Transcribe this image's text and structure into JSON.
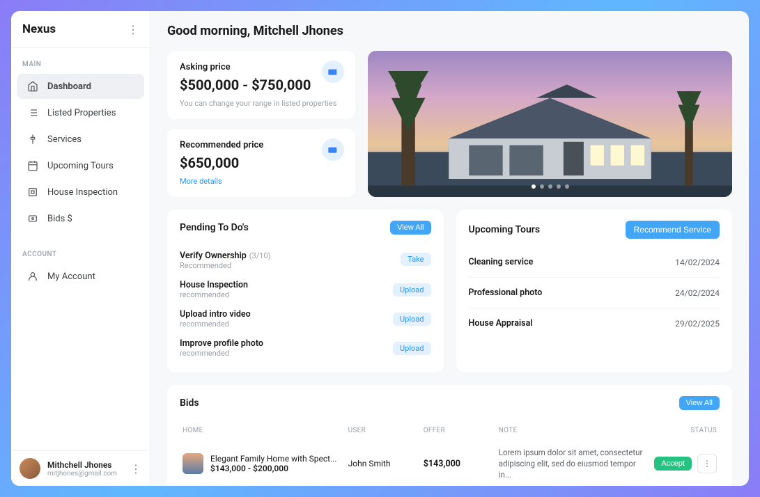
{
  "brand": "Nexus",
  "sidebar": {
    "sections": [
      {
        "label": "MAIN",
        "items": [
          {
            "label": "Dashboard",
            "name": "dashboard",
            "active": true
          },
          {
            "label": "Listed Properties",
            "name": "listed-properties"
          },
          {
            "label": "Services",
            "name": "services"
          },
          {
            "label": "Upcoming Tours",
            "name": "upcoming-tours"
          },
          {
            "label": "House Inspection",
            "name": "house-inspection"
          },
          {
            "label": "Bids $",
            "name": "bids"
          }
        ]
      },
      {
        "label": "ACCOUNT",
        "items": [
          {
            "label": "My Account",
            "name": "my-account"
          }
        ]
      }
    ],
    "user": {
      "name": "Mithchell Jhones",
      "email": "mitjhones@gmail.com"
    }
  },
  "greeting": "Good morning, Mitchell Jhones",
  "asking_price": {
    "title": "Asking price",
    "value": "$500,000 - $750,000",
    "note": "You can change your range in listed properties"
  },
  "recommended_price": {
    "title": "Recommended price",
    "value": "$650,000",
    "link": "More details"
  },
  "todos": {
    "title": "Pending To Do's",
    "view_all": "View All",
    "items": [
      {
        "title": "Verify Ownership",
        "count": "(3/10)",
        "sub": "Recommended",
        "action": "Take"
      },
      {
        "title": "House Inspection",
        "sub": "recommended",
        "action": "Upload"
      },
      {
        "title": "Upload intro video",
        "sub": "recommended",
        "action": "Upload"
      },
      {
        "title": "Improve profile photo",
        "sub": "recommended",
        "action": "Upload"
      }
    ]
  },
  "tours": {
    "title": "Upcoming Tours",
    "recommend_label": "Recommend Service",
    "items": [
      {
        "name": "Cleaning service",
        "date": "14/02/2024"
      },
      {
        "name": "Professional photo",
        "date": "24/02/2024"
      },
      {
        "name": "House Appraisal",
        "date": "29/02/2025"
      }
    ]
  },
  "bids": {
    "title": "Bids",
    "view_all": "View All",
    "columns": {
      "home": "HOME",
      "user": "USER",
      "offer": "OFFER",
      "note": "NOTE",
      "status": "STATUS"
    },
    "rows": [
      {
        "home_title": "Elegant Family Home with Spect...",
        "home_price": "$143,000 - $200,000",
        "user": "John Smith",
        "offer": "$143,000",
        "note": "Lorem ipsum dolor sit amet, consectetur adipiscing elit, sed do eiusmod tempor in...",
        "accept": "Accept"
      }
    ]
  }
}
